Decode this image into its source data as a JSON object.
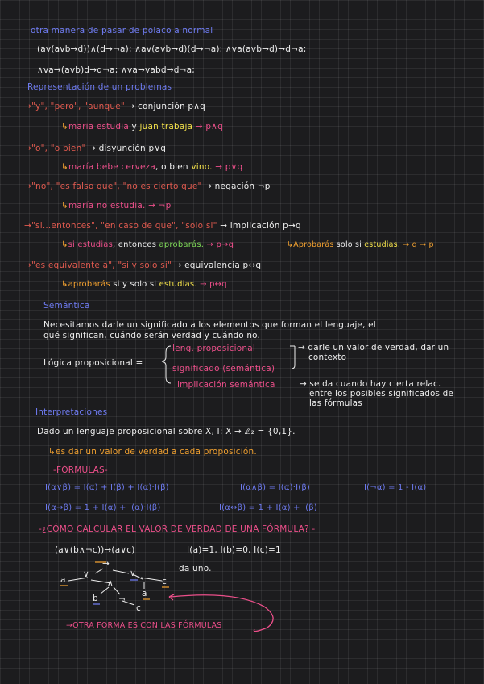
{
  "section1": {
    "title": "otra manera de pasar de polaco a normal",
    "line1": "(av(avb→d))∧(d→¬a);  ∧av(avb→d)(d→¬a);  ∧va(avb→d)→d¬a;",
    "line2": "∧va→(avb)d→d¬a;   ∧va→vabd→d¬a;"
  },
  "section2": {
    "title": "Representación de un problemas",
    "r1": {
      "quote": "→\"y\", \"pero\", \"aunque\"",
      "conn": "→ conjunción p∧q",
      "ex_a": "maria estudia",
      "ex_y": "y",
      "ex_b": "juan trabaja",
      "ex_r": "→ p∧q"
    },
    "r2": {
      "quote": "→\"o\", \"o bien\"",
      "conn": "→ disyunción p∨q",
      "ex_a": "maría bebe cerveza",
      "ex_m": ", o bien",
      "ex_b": "vino.",
      "ex_r": "→ p∨q"
    },
    "r3": {
      "quote": "→\"no\", \"es falso que\", \"no es cierto que\"",
      "conn": "→ negación ¬p",
      "ex_a": "maría no estudia.",
      "ex_r": "→ ¬p"
    },
    "r4": {
      "quote": "→\"si...entonces\", \"en caso de que\", \"solo si\"",
      "conn": "→ implicación p→q",
      "ex_a": "si estudias",
      "ex_m": ", entonces",
      "ex_b": "aprobarás.",
      "ex_r": "→ p→q",
      "ex2_a": "Aprobarás",
      "ex2_m": "solo si",
      "ex2_b": "estudias.",
      "ex2_r": "→ q → p"
    },
    "r5": {
      "quote": "→\"es equivalente a\", \"si y solo si\"",
      "conn": "→ equivalencia p↔q",
      "ex_a": "aprobarás",
      "ex_m": "si y solo si",
      "ex_b": "estudias.",
      "ex_r": "→ p↔q"
    }
  },
  "section3": {
    "title": "Semántica",
    "p1": "Necesitamos darle un significado a los elementos que forman el lenguaje, el",
    "p2": "qué significan, cuándo serán verdad y cuándo no.",
    "label": "Lógica proposicional =",
    "items": [
      "leng. proposicional",
      "significado (semántica)",
      "implicación semántica"
    ],
    "note1a": "→ darle un valor de verdad, dar un",
    "note1b": "contexto",
    "note2a": "→ se da cuando hay cierta relac.",
    "note2b": "entre los posibles significados de",
    "note2c": "las fórmulas"
  },
  "section4": {
    "title": "Interpretaciones",
    "p1": "Dado un lenguaje proposicional sobre X, I: X → ℤ₂ = {0,1}.",
    "p2": "es dar un valor de verdad a cada proposición.",
    "formulas_title": "-FÓRMULAS-",
    "f1": "I(α∨β) = I(α) + I(β) + I(α)·I(β)",
    "f2": "I(α∧β) = I(α)·I(β)",
    "f3": "I(¬α) = 1 - I(α)",
    "f4": "I(α→β) = 1 + I(α) + I(α)·I(β)",
    "f5": "I(α↔β) = 1 + I(α) + I(β)",
    "question": "-¿CÓMO CALCULAR EL VALOR DE VERDAD DE UNA FÓRMULA? -",
    "expr": "(a∨(b∧¬c))→(a∨c)",
    "vals": "I(a)=1, I(b)=0, I(c)=1",
    "da_uno": "da uno.",
    "tree": {
      "root": "→",
      "l": "∨",
      "r": "∨",
      "a1": "a",
      "and": "∧",
      "a2": "a",
      "c1": "c",
      "b": "b",
      "neg": "¬",
      "c2": "c"
    },
    "other": "→OTRA FORMA ES CON LAS FÓRMULAS"
  }
}
